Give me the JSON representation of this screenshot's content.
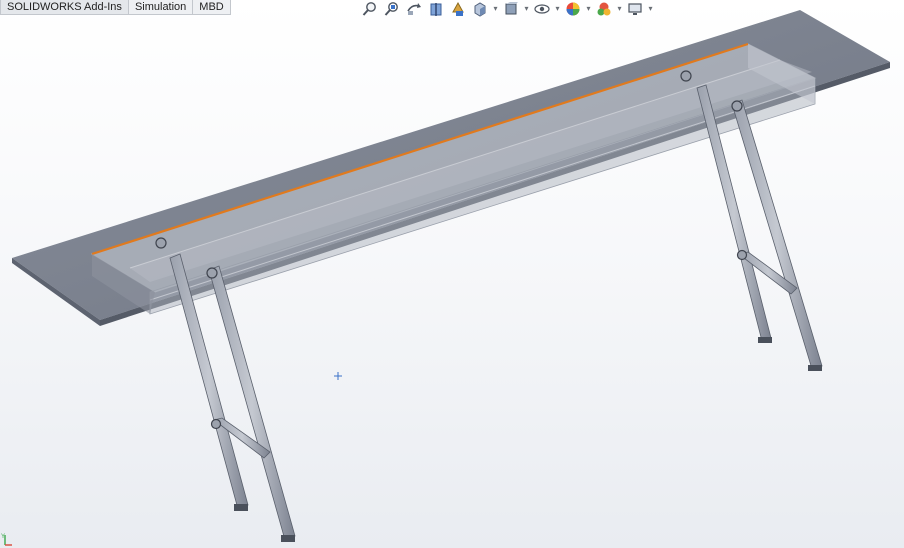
{
  "command_tabs": [
    {
      "label": "SOLIDWORKS Add-Ins"
    },
    {
      "label": "Simulation"
    },
    {
      "label": "MBD"
    }
  ],
  "heads_up_toolbar": [
    {
      "icon": "zoom-to-fit-icon"
    },
    {
      "icon": "zoom-to-area-icon"
    },
    {
      "icon": "previous-view-icon"
    },
    {
      "icon": "section-view-icon"
    },
    {
      "icon": "dynamic-annotation-views-icon"
    },
    {
      "icon": "view-orientation-icon",
      "dropdown": true
    },
    {
      "icon": "display-style-icon",
      "dropdown": true
    },
    {
      "icon": "hide-show-items-icon",
      "dropdown": true
    },
    {
      "icon": "edit-appearance-icon",
      "dropdown": true
    },
    {
      "icon": "apply-scene-icon",
      "dropdown": true
    },
    {
      "icon": "view-settings-icon",
      "dropdown": true
    }
  ],
  "colors": {
    "model_body": "#7b8190",
    "model_top": "#9aa0ad",
    "highlight_edge": "#e07a1e",
    "origin_marker": "#3a72c8",
    "background_top": "#ffffff",
    "background_bottom": "#e9ecf1"
  }
}
